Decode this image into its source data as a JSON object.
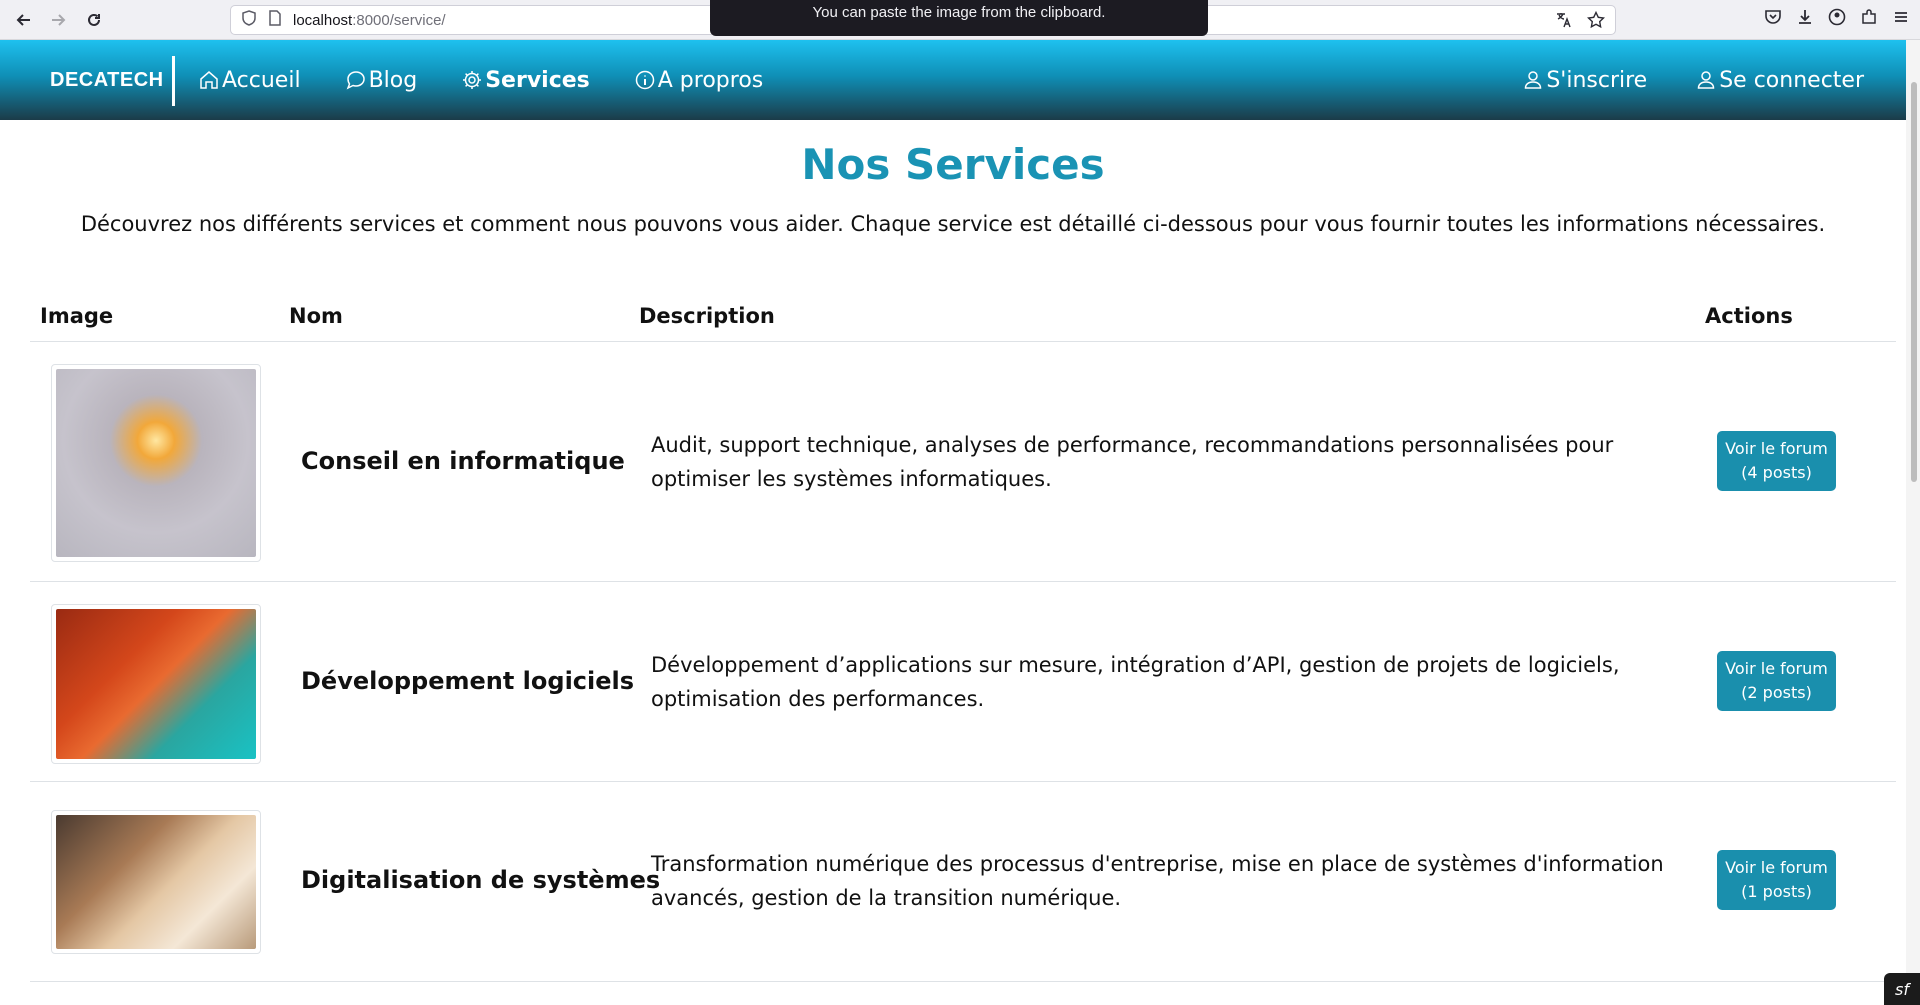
{
  "browser": {
    "url_host": "localhost",
    "url_rest": ":8000/service/",
    "toast": "You can paste the image from the clipboard."
  },
  "nav": {
    "brand": "DECATECH",
    "links": [
      {
        "label": "Accueil",
        "icon": "home-icon"
      },
      {
        "label": "Blog",
        "icon": "chat-icon"
      },
      {
        "label": "Services",
        "icon": "gear-icon"
      },
      {
        "label": "A propros",
        "icon": "info-icon"
      }
    ],
    "right": [
      {
        "label": "S'inscrire",
        "icon": "user-icon"
      },
      {
        "label": "Se connecter",
        "icon": "user-icon"
      }
    ]
  },
  "page": {
    "title": "Nos Services",
    "intro": "Découvrez nos différents services et comment nous pouvons vous aider. Chaque service est détaillé ci-dessous pour vous fournir toutes les informations nécessaires."
  },
  "table": {
    "headers": [
      "Image",
      "Nom",
      "Description",
      "Actions"
    ],
    "rows": [
      {
        "name": "Conseil en informatique",
        "description": "Audit, support technique, analyses de performance, recommandations personnalisées pour optimiser les systèmes informatiques.",
        "button_line1": "Voir le forum",
        "button_line2": "(4 posts)"
      },
      {
        "name": "Développement logiciels",
        "description": "Développement d’applications sur mesure, intégration d’API, gestion de projets de logiciels, optimisation des performances.",
        "button_line1": "Voir le forum",
        "button_line2": "(2 posts)"
      },
      {
        "name": "Digitalisation de systèmes",
        "description": "Transformation numérique des processus d'entreprise, mise en place de systèmes d'information avancés, gestion de la transition numérique.",
        "button_line1": "Voir le forum",
        "button_line2": "(1 posts)"
      }
    ]
  },
  "colors": {
    "accent": "#1a93b4",
    "button": "#1a8fad"
  }
}
